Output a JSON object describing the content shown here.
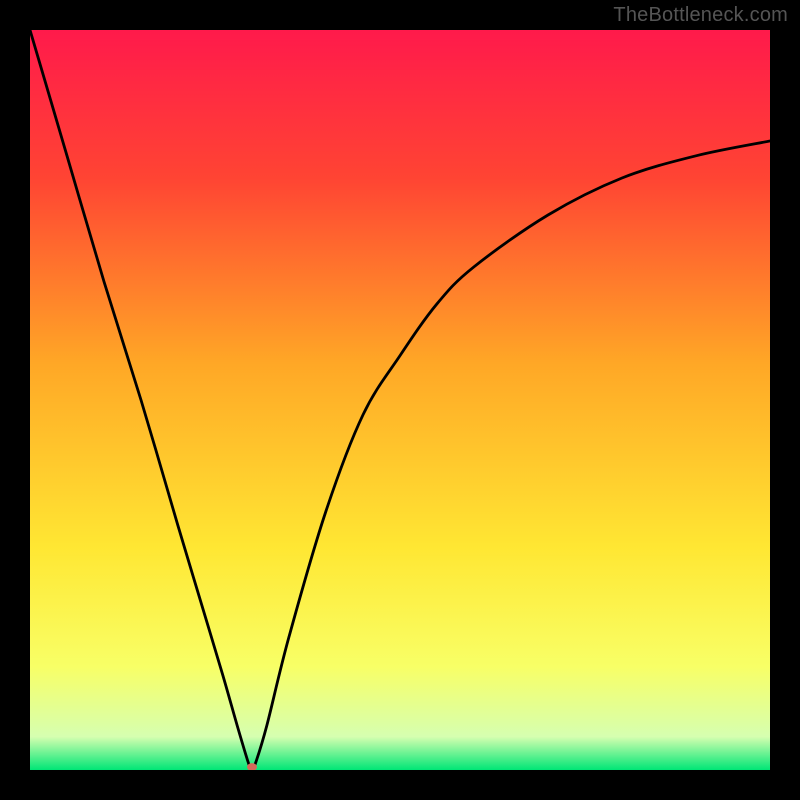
{
  "watermark": "TheBottleneck.com",
  "chart_data": {
    "type": "line",
    "title": "",
    "subtitle": "",
    "xlabel": "",
    "ylabel": "",
    "xlim": [
      0,
      100
    ],
    "ylim": [
      0,
      100
    ],
    "grid": false,
    "legend": false,
    "background_gradient_stops": [
      {
        "pos": 0.0,
        "color": "#ff1a4b"
      },
      {
        "pos": 0.2,
        "color": "#ff4433"
      },
      {
        "pos": 0.45,
        "color": "#ffa726"
      },
      {
        "pos": 0.7,
        "color": "#ffe733"
      },
      {
        "pos": 0.86,
        "color": "#f8ff66"
      },
      {
        "pos": 0.955,
        "color": "#d6ffb0"
      },
      {
        "pos": 1.0,
        "color": "#00e676"
      }
    ],
    "marker": {
      "x": 30,
      "y": 0,
      "color": "#d46a5a",
      "radius": 5
    },
    "series": [
      {
        "name": "curve",
        "x": [
          0,
          5,
          10,
          15,
          20,
          23,
          26,
          28,
          29.5,
          30,
          30.5,
          32,
          35,
          40,
          45,
          50,
          55,
          60,
          70,
          80,
          90,
          100
        ],
        "y": [
          100,
          83,
          66,
          50,
          33,
          23,
          13,
          6,
          1,
          0,
          1,
          6,
          18,
          35,
          48,
          56,
          63,
          68,
          75,
          80,
          83,
          85
        ]
      }
    ]
  }
}
